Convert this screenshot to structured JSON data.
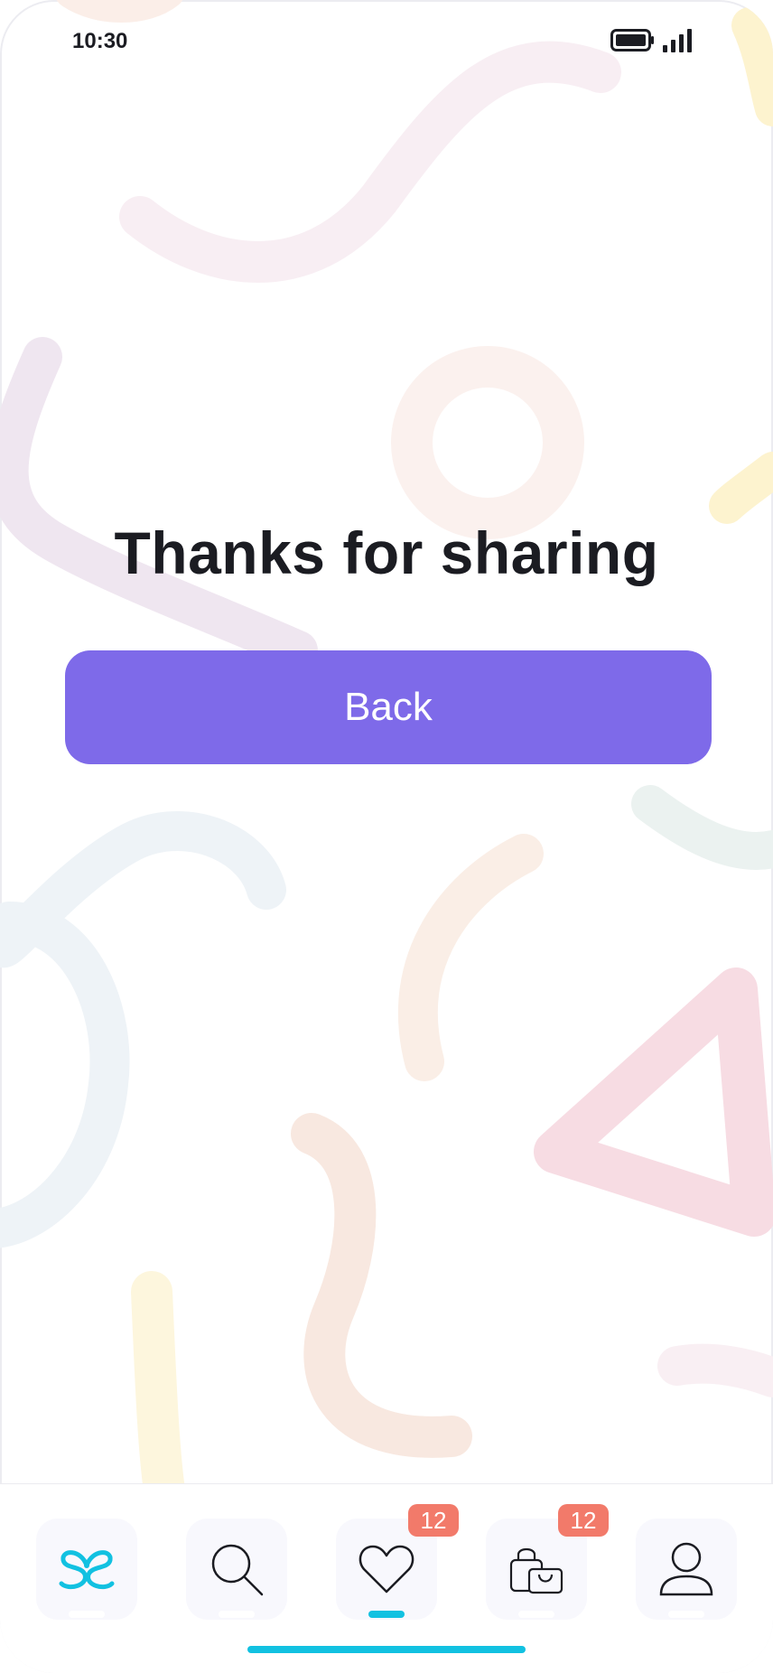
{
  "status_bar": {
    "time": "10:30",
    "icons": [
      "battery-icon",
      "signal-icon"
    ]
  },
  "main": {
    "title": "Thanks for sharing",
    "back_label": "Back"
  },
  "tab_bar": {
    "items": [
      {
        "icon": "app-logo-icon",
        "badge": null,
        "active": false
      },
      {
        "icon": "search-icon",
        "badge": null,
        "active": false
      },
      {
        "icon": "heart-icon",
        "badge": "12",
        "active": true
      },
      {
        "icon": "shopping-bags-icon",
        "badge": "12",
        "active": false
      },
      {
        "icon": "profile-icon",
        "badge": null,
        "active": false
      }
    ]
  },
  "colors": {
    "accent": "#7e6ae9",
    "tab_active": "#12c1e1",
    "badge": "#f27a6a",
    "text": "#1b1c22"
  }
}
